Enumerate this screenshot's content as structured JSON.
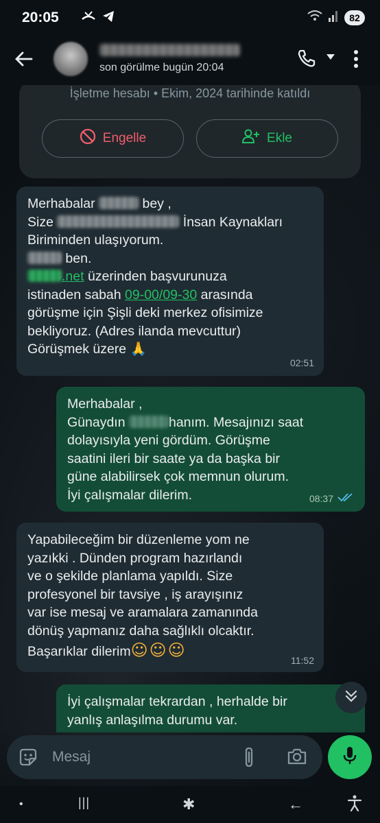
{
  "status_bar": {
    "time": "20:05",
    "battery": "82",
    "icons": [
      "missed-call-icon",
      "telegram-icon",
      "wifi-icon",
      "signal-icon",
      "battery-icon"
    ]
  },
  "header": {
    "contact_name": "",
    "last_seen": "son görülme bugün 20:04",
    "icons": [
      "back-arrow-icon",
      "avatar",
      "phone-icon",
      "caret-down-icon",
      "more-vert-icon"
    ]
  },
  "business_card": {
    "info": "İşletme hesabı • Ekim, 2024 tarihinde katıldı",
    "block_label": "Engelle",
    "add_label": "Ekle"
  },
  "messages": [
    {
      "direction": "incoming",
      "lines": [
        [
          "Merhabalar ",
          "[blurred]",
          " bey ,"
        ],
        [
          "Size ",
          "[blurred]",
          " İnsan Kaynakları"
        ],
        [
          "Biriminden ulaşıyorum."
        ],
        [
          "[blurred]",
          " ben."
        ],
        [
          "[blurred-link]",
          ".net",
          " üzerinden başvurunuza"
        ],
        [
          "istinaden sabah ",
          "09-00/09-30",
          " arasında"
        ],
        [
          "görüşme için Şişli deki merkez ofisimize"
        ],
        [
          "bekliyoruz. (Adres ilanda mevcuttur)"
        ],
        [
          "Görüşmek üzere 🙏"
        ]
      ],
      "l1a": "Merhabalar ",
      "l1b": " bey ,",
      "l2a": "Size ",
      "l2b": " İnsan Kaynakları",
      "l3": "Biriminden ulaşıyorum.",
      "l4": " ben.",
      "l5a": ".net",
      "l5b": " üzerinden başvurunuza",
      "l6a": "istinaden sabah ",
      "l6b": "09-00/09-30",
      "l6c": " arasında",
      "l7": "görüşme için Şişli deki merkez ofisimize",
      "l8": "bekliyoruz. (Adres ilanda mevcuttur)",
      "l9": "Görüşmek üzere ",
      "l9emoji": "🙏",
      "time": "02:51"
    },
    {
      "direction": "outgoing",
      "l1": "Merhabalar ,",
      "l2a": "Günaydın ",
      "l2b": "hanım. Mesajınızı saat",
      "l3": "dolayısıyla yeni gördüm. Görüşme",
      "l4": "saatini ileri bir saate ya da başka bir",
      "l5": "güne alabilirsek çok memnun olurum.",
      "l6": "İyi çalışmalar dilerim.",
      "time": "08:37",
      "status": "read"
    },
    {
      "direction": "incoming",
      "l1": "Yapabileceğim bir düzenleme yom ne",
      "l2": "yazıkki . Dünden program hazırlandı",
      "l3": "ve o şekilde planlama yapıldı. Size",
      "l4": "profesyonel bir tavsiye , iş arayışınız",
      "l5": "var ise mesaj ve aramalara zamanında",
      "l6": "dönüş yapmanız daha sağlıklı olcaktır.",
      "l7": "Başarıklar dilerim",
      "l7emoji": "☺☺☺",
      "time": "11:52"
    },
    {
      "direction": "outgoing",
      "l1": "İyi çalışmalar tekrardan , herhalde bir",
      "l2": "yanlış anlaşılma durumu var."
    }
  ],
  "input": {
    "placeholder": "Mesaj"
  },
  "nav": {
    "dot": "•",
    "recents": "|||",
    "home": "✱",
    "back": "←"
  },
  "colors": {
    "incoming_bubble": "#202c33",
    "outgoing_bubble": "#144d37",
    "accent_green": "#21c063",
    "danger_red": "#f15c6d",
    "read_tick": "#53bdeb"
  }
}
